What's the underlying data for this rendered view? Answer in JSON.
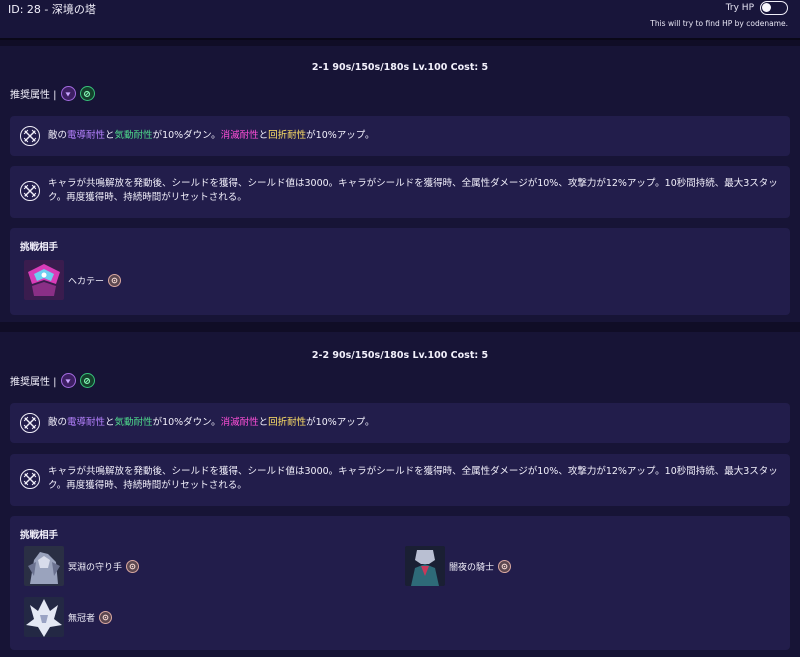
{
  "header": {
    "title": "ID: 28 - 深境の塔",
    "try_hp_label": "Try HP",
    "try_hp_note": "This will try to find HP by codename.",
    "try_hp_enabled": false
  },
  "sections": [
    {
      "header": "2-1 90s/150s/180s Lv.100 Cost: 5",
      "recommended_label": "推奨属性 |",
      "recommended_icons": [
        "spectro-attribute-icon",
        "aero-attribute-icon"
      ],
      "effect1": {
        "prefix": "敵の",
        "attr_a": "電導耐性",
        "join1": "と",
        "attr_b": "気動耐性",
        "mid": "が10%ダウン。",
        "attr_c": "消滅耐性",
        "join2": "と",
        "attr_d": "回折耐性",
        "suffix": "が10%アップ。"
      },
      "effect2": "キャラが共鳴解放を発動後、シールドを獲得、シールド値は3000。キャラがシールドを獲得時、全属性ダメージが10%、攻撃力が12%アップ。10秒間持続、最大3スタック。再度獲得時、持続時間がリセットされる。",
      "opponents_title": "挑戦相手",
      "opponents": [
        {
          "name": "ヘカテー",
          "element_icon": "havoc-element-icon"
        }
      ]
    },
    {
      "header": "2-2 90s/150s/180s Lv.100 Cost: 5",
      "recommended_label": "推奨属性 |",
      "recommended_icons": [
        "spectro-attribute-icon",
        "aero-attribute-icon"
      ],
      "effect1": {
        "prefix": "敵の",
        "attr_a": "電導耐性",
        "join1": "と",
        "attr_b": "気動耐性",
        "mid": "が10%ダウン。",
        "attr_c": "消滅耐性",
        "join2": "と",
        "attr_d": "回折耐性",
        "suffix": "が10%アップ。"
      },
      "effect2": "キャラが共鳴解放を発動後、シールドを獲得、シールド値は3000。キャラがシールドを獲得時、全属性ダメージが10%、攻撃力が12%アップ。10秒間持続、最大3スタック。再度獲得時、持続時間がリセットされる。",
      "opponents_title": "挑戦相手",
      "opponents": [
        {
          "name": "冥淵の守り手",
          "element_icon": "havoc-element-icon"
        },
        {
          "name": "闇夜の騎士",
          "element_icon": "havoc-element-icon"
        },
        {
          "name": "無冠者",
          "element_icon": "havoc-element-icon"
        }
      ]
    }
  ],
  "colors": {
    "background": "#100d26",
    "card": "#221d4b",
    "purple_highlight": "#b682ff",
    "green_highlight": "#4fdc8c",
    "pink_highlight": "#ff4fd8",
    "yellow_highlight": "#ffe066"
  }
}
